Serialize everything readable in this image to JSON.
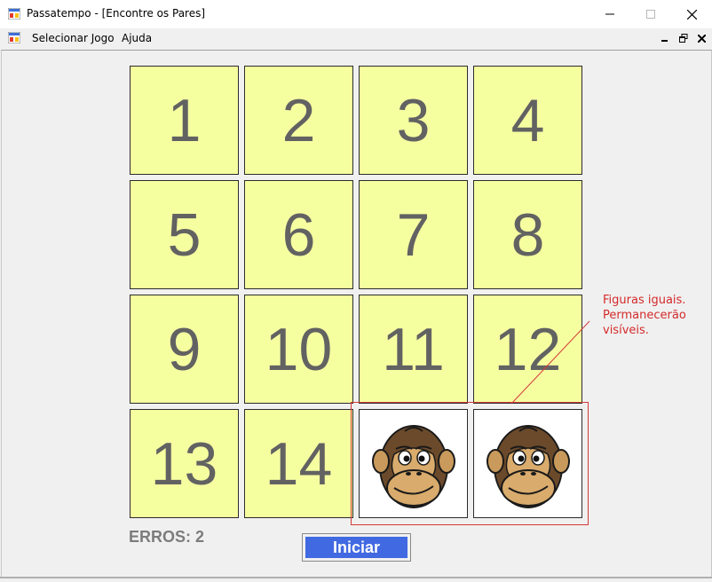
{
  "window": {
    "title": "Passatempo - [Encontre os Pares]"
  },
  "menu": {
    "items": [
      {
        "label": "Selecionar Jogo"
      },
      {
        "label": "Ajuda"
      }
    ]
  },
  "board": {
    "tiles": [
      {
        "label": "1"
      },
      {
        "label": "2"
      },
      {
        "label": "3"
      },
      {
        "label": "4"
      },
      {
        "label": "5"
      },
      {
        "label": "6"
      },
      {
        "label": "7"
      },
      {
        "label": "8"
      },
      {
        "label": "9"
      },
      {
        "label": "10"
      },
      {
        "label": "11"
      },
      {
        "label": "12"
      },
      {
        "label": "13"
      },
      {
        "label": "14"
      },
      {
        "label": "",
        "image": "monkey-icon"
      },
      {
        "label": "",
        "image": "monkey-icon"
      }
    ],
    "tile_color": "#f6ffa0",
    "number_color": "#626262"
  },
  "status": {
    "errors_label": "ERROS: 2"
  },
  "start_button": {
    "label": "Iniciar",
    "color": "#4169e1"
  },
  "annotation": {
    "lines": [
      "Figuras iguais.",
      "Permanecerão",
      "visíveis."
    ],
    "color": "#d42a2a"
  }
}
